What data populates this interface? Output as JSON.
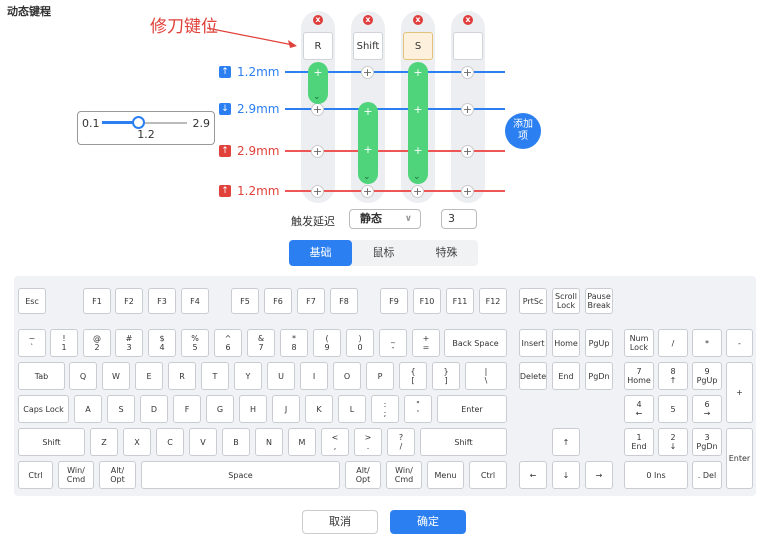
{
  "page": {
    "title": "动态键程",
    "annotation": "修刀键位"
  },
  "range": {
    "min": "0.1",
    "max": "2.9",
    "value": "1.2"
  },
  "levels": [
    {
      "label": "1.2mm",
      "icon": "↑",
      "color": "#2b7ff0"
    },
    {
      "label": "2.9mm",
      "icon": "↓",
      "color": "#2b7ff0"
    },
    {
      "label": "2.9mm",
      "icon": "↑",
      "color": "#e0413a"
    },
    {
      "label": "1.2mm",
      "icon": "↑",
      "color": "#e0413a"
    }
  ],
  "columns": [
    {
      "key": "R",
      "remove": "x",
      "selected": false
    },
    {
      "key": "Shift",
      "remove": "x",
      "selected": false
    },
    {
      "key": "S",
      "remove": "x",
      "selected": true
    },
    {
      "key": "",
      "remove": "x",
      "selected": false
    }
  ],
  "add_button": {
    "line1": "添加",
    "line2": "项"
  },
  "delay": {
    "label": "触发延迟",
    "mode": "静态",
    "value": "3"
  },
  "tabs": [
    {
      "label": "基础",
      "active": true
    },
    {
      "label": "鼠标",
      "active": false
    },
    {
      "label": "特殊",
      "active": false
    }
  ],
  "keyboard": {
    "row_fn": [
      "Esc",
      "F1",
      "F2",
      "F3",
      "F4",
      "F5",
      "F6",
      "F7",
      "F8",
      "F9",
      "F10",
      "F11",
      "F12",
      "PrtSc",
      "Scroll\nLock",
      "Pause\nBreak"
    ],
    "row_num": [
      "~\n`",
      "!\n1",
      "@\n2",
      "#\n3",
      "$\n4",
      "%\n5",
      "^\n6",
      "&\n7",
      "*\n8",
      "(\n9",
      ")\n0",
      "_\n-",
      "+\n=",
      "Back Space",
      "Insert",
      "Home",
      "PgUp",
      "Num\nLock",
      "/",
      "*",
      "-"
    ],
    "row_tab": [
      "Tab",
      "Q",
      "W",
      "E",
      "R",
      "T",
      "Y",
      "U",
      "I",
      "O",
      "P",
      "{\n[",
      "}\n]",
      "|\n\\",
      "Delete",
      "End",
      "PgDn",
      "7\nHome",
      "8\n↑",
      "9\nPgUp",
      "+"
    ],
    "row_caps": [
      "Caps Lock",
      "A",
      "S",
      "D",
      "F",
      "G",
      "H",
      "J",
      "K",
      "L",
      ":\n;",
      "\"\n'",
      "Enter",
      "4\n←",
      "5",
      "6\n→"
    ],
    "row_shift": [
      "Shift",
      "Z",
      "X",
      "C",
      "V",
      "B",
      "N",
      "M",
      "<\n,",
      ">\n.",
      "?\n/",
      "Shift",
      "↑",
      "1\nEnd",
      "2\n↓",
      "3\nPgDn",
      "Enter"
    ],
    "row_ctrl": [
      "Ctrl",
      "Win/\nCmd",
      "Alt/\nOpt",
      "Space",
      "Alt/\nOpt",
      "Win/\nCmd",
      "Menu",
      "Ctrl",
      "←",
      "↓",
      "→",
      "0 Ins",
      ". Del"
    ]
  },
  "footer": {
    "cancel": "取消",
    "confirm": "确定"
  }
}
